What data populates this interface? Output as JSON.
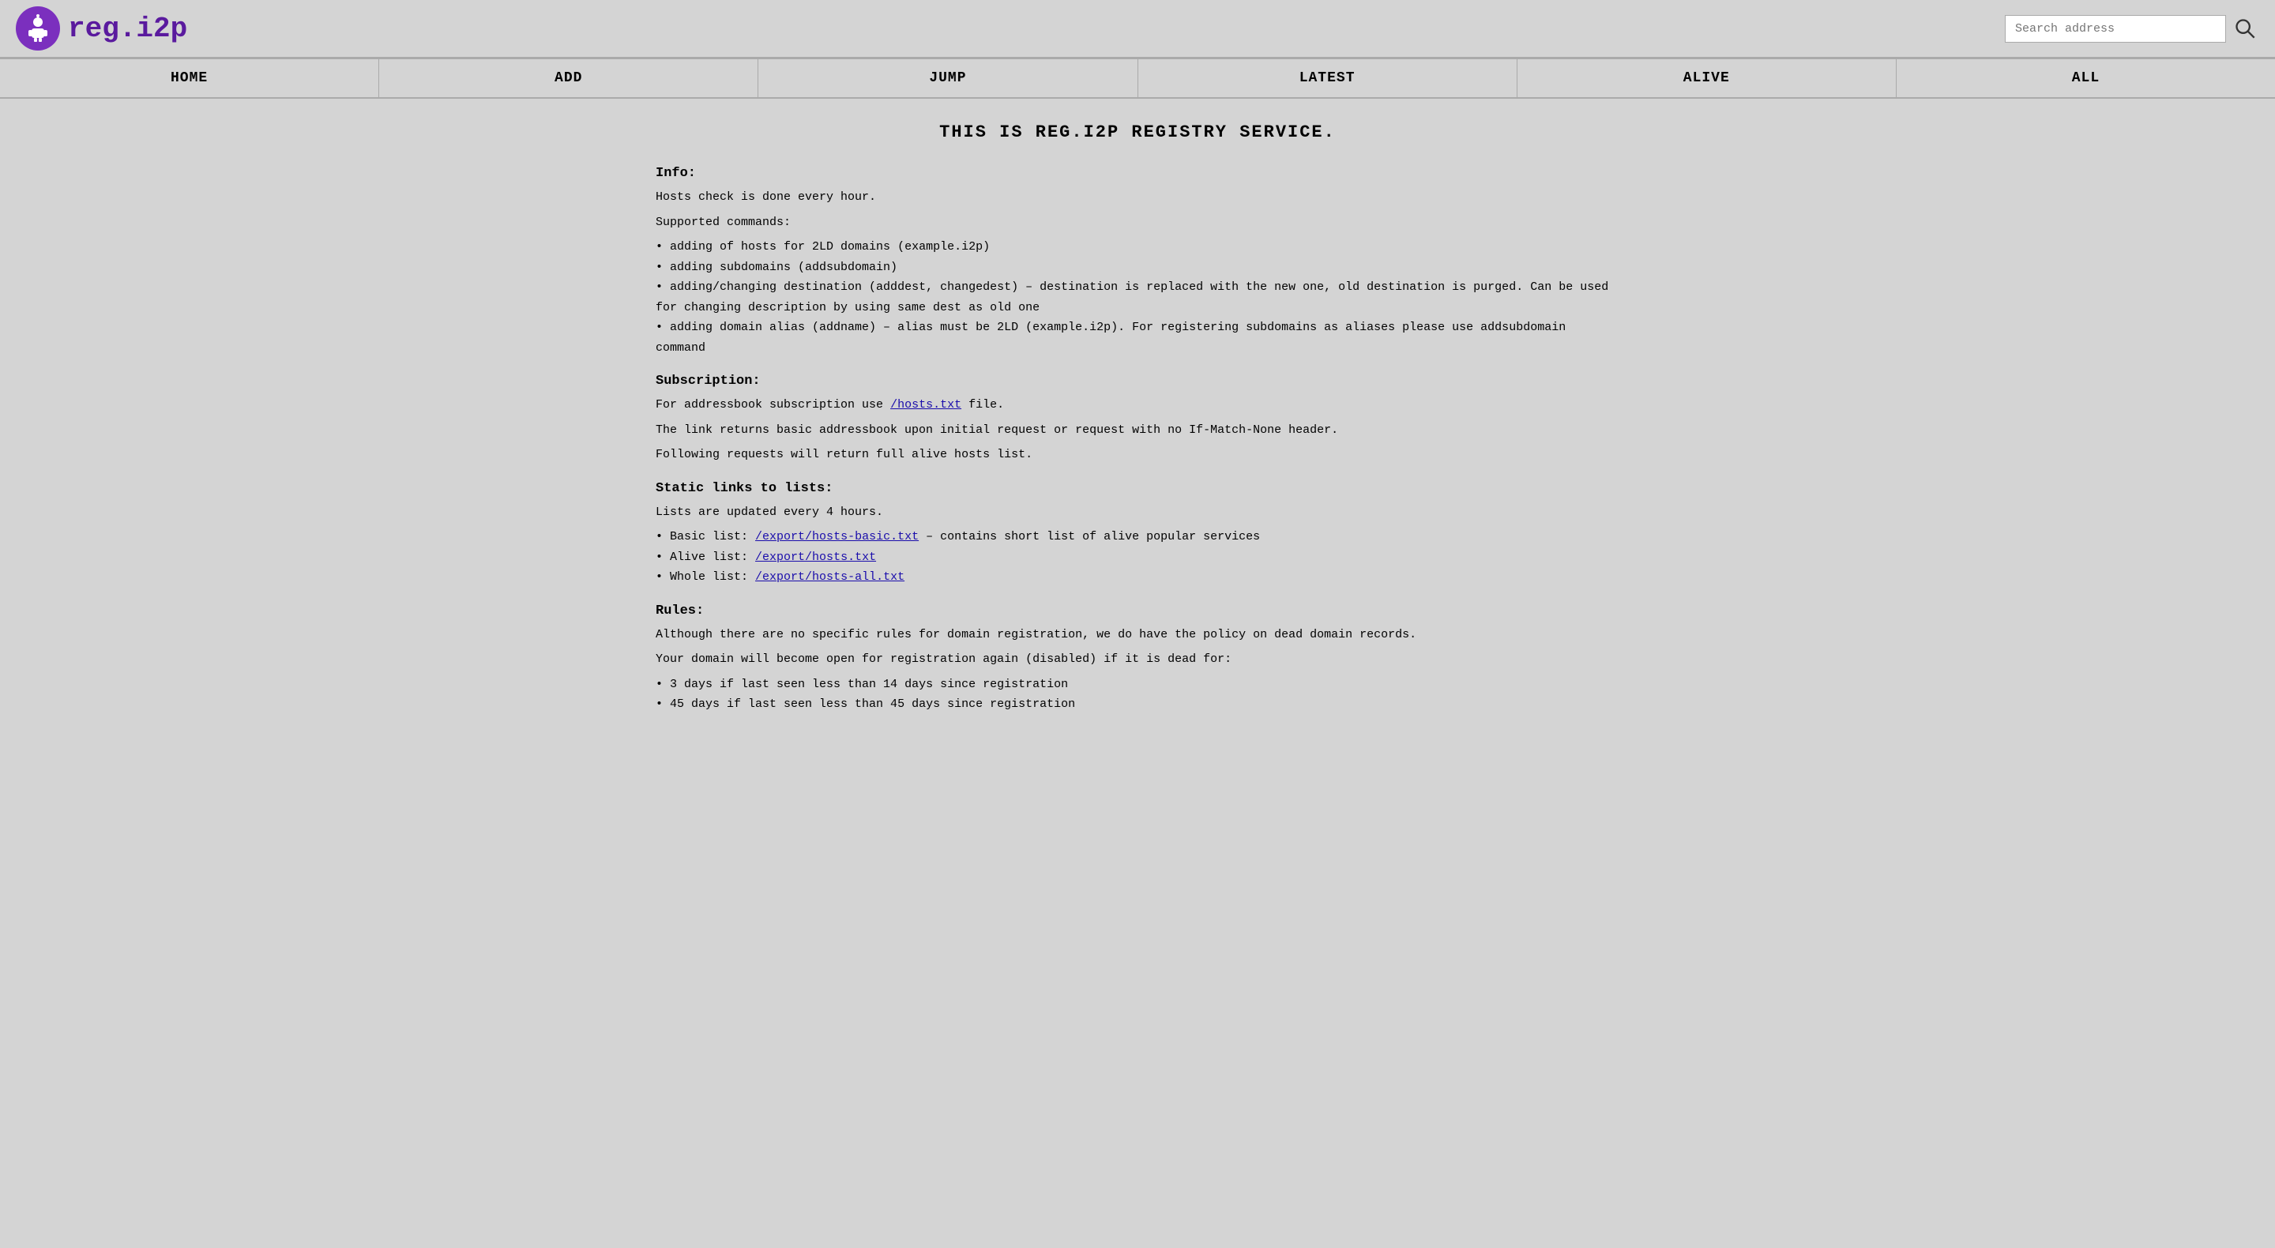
{
  "header": {
    "logo_text": "reg.i2p",
    "search_placeholder": "Search address"
  },
  "nav": {
    "items": [
      {
        "label": "HOME",
        "href": "#home"
      },
      {
        "label": "ADD",
        "href": "#add"
      },
      {
        "label": "JUMP",
        "href": "#jump"
      },
      {
        "label": "LATEST",
        "href": "#latest"
      },
      {
        "label": "ALIVE",
        "href": "#alive"
      },
      {
        "label": "ALL",
        "href": "#all"
      }
    ]
  },
  "main": {
    "page_title": "THIS IS REG.I2P REGISTRY SERVICE.",
    "sections": {
      "info": {
        "heading": "Info:",
        "paragraph1": "Hosts check is done every hour.",
        "paragraph2": "Supported commands:",
        "bullets": [
          "adding of hosts for 2LD domains (example.i2p)",
          "adding subdomains (addsubdomain)",
          "adding/changing destination (adddest, changedest) – destination is replaced with the new one, old destination is purged. Can be used for changing description by using same dest as old one",
          "adding domain alias (addname) – alias must be 2LD (example.i2p). For registering subdomains as aliases please use addsubdomain command"
        ]
      },
      "subscription": {
        "heading": "Subscription:",
        "text_before_link": "For addressbook subscription use ",
        "link_text": "/hosts.txt",
        "link_href": "/hosts.txt",
        "text_after_link": " file.",
        "paragraph2": "The link returns basic addressbook upon initial request or request with no If-Match-None header.",
        "paragraph3": "Following requests will return full alive hosts list."
      },
      "static_links": {
        "heading": "Static links to lists:",
        "paragraph1": "Lists are updated every 4 hours.",
        "bullets": [
          {
            "text_before": "Basic list: ",
            "link_text": "/export/hosts-basic.txt",
            "link_href": "/export/hosts-basic.txt",
            "text_after": " – contains short list of alive popular services"
          },
          {
            "text_before": "Alive list: ",
            "link_text": "/export/hosts.txt",
            "link_href": "/export/hosts.txt",
            "text_after": ""
          },
          {
            "text_before": "Whole list: ",
            "link_text": "/export/hosts-all.txt",
            "link_href": "/export/hosts-all.txt",
            "text_after": ""
          }
        ]
      },
      "rules": {
        "heading": "Rules:",
        "paragraph1": "Although there are no specific rules for domain registration, we do have the policy on dead domain records.",
        "paragraph2": "Your domain will become open for registration again (disabled) if it is dead for:",
        "bullets": [
          "3 days if last seen less than 14 days since registration",
          "45 days if last seen less than 45 days since registration"
        ]
      }
    }
  }
}
